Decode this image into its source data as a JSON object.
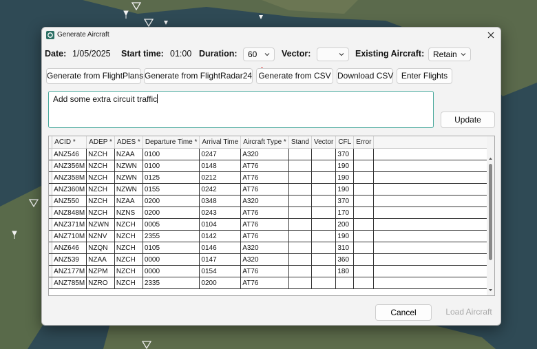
{
  "window": {
    "title": "Generate Aircraft"
  },
  "form": {
    "date_label": "Date:",
    "date_value": "1/05/2025",
    "start_label": "Start time:",
    "start_value": "01:00",
    "duration_label": "Duration:",
    "duration_value": "60",
    "vector_label": "Vector:",
    "vector_value": "",
    "existing_label": "Existing Aircraft:",
    "existing_value": "Retain"
  },
  "actions": {
    "flightplans": "Generate from FlightPlans",
    "flightradar": "Generate from FlightRadar24",
    "csv": "Generate from CSV",
    "download": "Download CSV",
    "enter": "Enter Flights",
    "update": "Update"
  },
  "prompt": {
    "value": "Add some extra circuit traffic"
  },
  "table": {
    "columns": [
      "ACID *",
      "ADEP *",
      "ADES *",
      "Departure Time *",
      "Arrival Time",
      "Aircraft Type *",
      "Stand",
      "Vector",
      "CFL",
      "Error"
    ],
    "rows": [
      [
        "ANZ546",
        "NZCH",
        "NZAA",
        "0100",
        "0247",
        "A320",
        "",
        "",
        "370",
        ""
      ],
      [
        "ANZ356M",
        "NZCH",
        "NZWN",
        "0100",
        "0148",
        "AT76",
        "",
        "",
        "190",
        ""
      ],
      [
        "ANZ358M",
        "NZCH",
        "NZWN",
        "0125",
        "0212",
        "AT76",
        "",
        "",
        "190",
        ""
      ],
      [
        "ANZ360M",
        "NZCH",
        "NZWN",
        "0155",
        "0242",
        "AT76",
        "",
        "",
        "190",
        ""
      ],
      [
        "ANZ550",
        "NZCH",
        "NZAA",
        "0200",
        "0348",
        "A320",
        "",
        "",
        "370",
        ""
      ],
      [
        "ANZ848M",
        "NZCH",
        "NZNS",
        "0200",
        "0243",
        "AT76",
        "",
        "",
        "170",
        ""
      ],
      [
        "ANZ371M",
        "NZWN",
        "NZCH",
        "0005",
        "0104",
        "AT76",
        "",
        "",
        "200",
        ""
      ],
      [
        "ANZ710M",
        "NZNV",
        "NZCH",
        "2355",
        "0142",
        "AT76",
        "",
        "",
        "190",
        ""
      ],
      [
        "ANZ646",
        "NZQN",
        "NZCH",
        "0105",
        "0146",
        "A320",
        "",
        "",
        "310",
        ""
      ],
      [
        "ANZ539",
        "NZAA",
        "NZCH",
        "0000",
        "0147",
        "A320",
        "",
        "",
        "360",
        ""
      ],
      [
        "ANZ177M",
        "NZPM",
        "NZCH",
        "0000",
        "0154",
        "AT76",
        "",
        "",
        "180",
        ""
      ],
      [
        "ANZ785M",
        "NZRO",
        "NZCH",
        "2335",
        "0200",
        "AT76",
        "",
        "",
        "",
        ""
      ]
    ]
  },
  "footer": {
    "cancel": "Cancel",
    "load": "Load Aircraft"
  }
}
